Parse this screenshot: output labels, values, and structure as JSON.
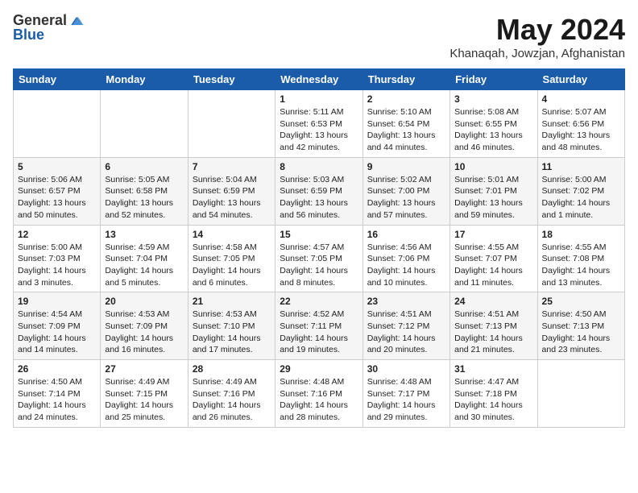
{
  "logo": {
    "general": "General",
    "blue": "Blue"
  },
  "header": {
    "month_title": "May 2024",
    "location": "Khanaqah, Jowzjan, Afghanistan"
  },
  "days_of_week": [
    "Sunday",
    "Monday",
    "Tuesday",
    "Wednesday",
    "Thursday",
    "Friday",
    "Saturday"
  ],
  "weeks": [
    [
      {
        "day": "",
        "info": ""
      },
      {
        "day": "",
        "info": ""
      },
      {
        "day": "",
        "info": ""
      },
      {
        "day": "1",
        "info": "Sunrise: 5:11 AM\nSunset: 6:53 PM\nDaylight: 13 hours\nand 42 minutes."
      },
      {
        "day": "2",
        "info": "Sunrise: 5:10 AM\nSunset: 6:54 PM\nDaylight: 13 hours\nand 44 minutes."
      },
      {
        "day": "3",
        "info": "Sunrise: 5:08 AM\nSunset: 6:55 PM\nDaylight: 13 hours\nand 46 minutes."
      },
      {
        "day": "4",
        "info": "Sunrise: 5:07 AM\nSunset: 6:56 PM\nDaylight: 13 hours\nand 48 minutes."
      }
    ],
    [
      {
        "day": "5",
        "info": "Sunrise: 5:06 AM\nSunset: 6:57 PM\nDaylight: 13 hours\nand 50 minutes."
      },
      {
        "day": "6",
        "info": "Sunrise: 5:05 AM\nSunset: 6:58 PM\nDaylight: 13 hours\nand 52 minutes."
      },
      {
        "day": "7",
        "info": "Sunrise: 5:04 AM\nSunset: 6:59 PM\nDaylight: 13 hours\nand 54 minutes."
      },
      {
        "day": "8",
        "info": "Sunrise: 5:03 AM\nSunset: 6:59 PM\nDaylight: 13 hours\nand 56 minutes."
      },
      {
        "day": "9",
        "info": "Sunrise: 5:02 AM\nSunset: 7:00 PM\nDaylight: 13 hours\nand 57 minutes."
      },
      {
        "day": "10",
        "info": "Sunrise: 5:01 AM\nSunset: 7:01 PM\nDaylight: 13 hours\nand 59 minutes."
      },
      {
        "day": "11",
        "info": "Sunrise: 5:00 AM\nSunset: 7:02 PM\nDaylight: 14 hours\nand 1 minute."
      }
    ],
    [
      {
        "day": "12",
        "info": "Sunrise: 5:00 AM\nSunset: 7:03 PM\nDaylight: 14 hours\nand 3 minutes."
      },
      {
        "day": "13",
        "info": "Sunrise: 4:59 AM\nSunset: 7:04 PM\nDaylight: 14 hours\nand 5 minutes."
      },
      {
        "day": "14",
        "info": "Sunrise: 4:58 AM\nSunset: 7:05 PM\nDaylight: 14 hours\nand 6 minutes."
      },
      {
        "day": "15",
        "info": "Sunrise: 4:57 AM\nSunset: 7:05 PM\nDaylight: 14 hours\nand 8 minutes."
      },
      {
        "day": "16",
        "info": "Sunrise: 4:56 AM\nSunset: 7:06 PM\nDaylight: 14 hours\nand 10 minutes."
      },
      {
        "day": "17",
        "info": "Sunrise: 4:55 AM\nSunset: 7:07 PM\nDaylight: 14 hours\nand 11 minutes."
      },
      {
        "day": "18",
        "info": "Sunrise: 4:55 AM\nSunset: 7:08 PM\nDaylight: 14 hours\nand 13 minutes."
      }
    ],
    [
      {
        "day": "19",
        "info": "Sunrise: 4:54 AM\nSunset: 7:09 PM\nDaylight: 14 hours\nand 14 minutes."
      },
      {
        "day": "20",
        "info": "Sunrise: 4:53 AM\nSunset: 7:09 PM\nDaylight: 14 hours\nand 16 minutes."
      },
      {
        "day": "21",
        "info": "Sunrise: 4:53 AM\nSunset: 7:10 PM\nDaylight: 14 hours\nand 17 minutes."
      },
      {
        "day": "22",
        "info": "Sunrise: 4:52 AM\nSunset: 7:11 PM\nDaylight: 14 hours\nand 19 minutes."
      },
      {
        "day": "23",
        "info": "Sunrise: 4:51 AM\nSunset: 7:12 PM\nDaylight: 14 hours\nand 20 minutes."
      },
      {
        "day": "24",
        "info": "Sunrise: 4:51 AM\nSunset: 7:13 PM\nDaylight: 14 hours\nand 21 minutes."
      },
      {
        "day": "25",
        "info": "Sunrise: 4:50 AM\nSunset: 7:13 PM\nDaylight: 14 hours\nand 23 minutes."
      }
    ],
    [
      {
        "day": "26",
        "info": "Sunrise: 4:50 AM\nSunset: 7:14 PM\nDaylight: 14 hours\nand 24 minutes."
      },
      {
        "day": "27",
        "info": "Sunrise: 4:49 AM\nSunset: 7:15 PM\nDaylight: 14 hours\nand 25 minutes."
      },
      {
        "day": "28",
        "info": "Sunrise: 4:49 AM\nSunset: 7:16 PM\nDaylight: 14 hours\nand 26 minutes."
      },
      {
        "day": "29",
        "info": "Sunrise: 4:48 AM\nSunset: 7:16 PM\nDaylight: 14 hours\nand 28 minutes."
      },
      {
        "day": "30",
        "info": "Sunrise: 4:48 AM\nSunset: 7:17 PM\nDaylight: 14 hours\nand 29 minutes."
      },
      {
        "day": "31",
        "info": "Sunrise: 4:47 AM\nSunset: 7:18 PM\nDaylight: 14 hours\nand 30 minutes."
      },
      {
        "day": "",
        "info": ""
      }
    ]
  ]
}
